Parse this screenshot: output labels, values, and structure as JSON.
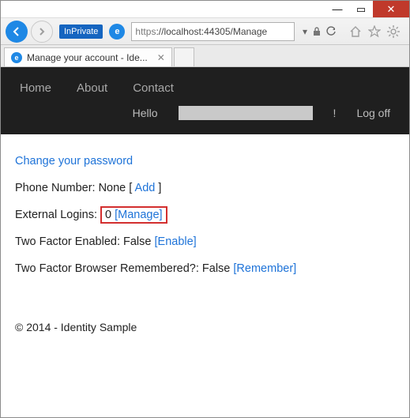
{
  "titlebar": {
    "min": "—",
    "max": "▭",
    "close": "✕"
  },
  "nav": {
    "inprivate": "InPrivate",
    "url_scheme": "https",
    "url_rest": "://localhost:44305/Manage"
  },
  "tab": {
    "title": "Manage your account - Ide..."
  },
  "site_nav": {
    "home": "Home",
    "about": "About",
    "contact": "Contact",
    "hello": "Hello",
    "bang": "!",
    "logoff": "Log off"
  },
  "page": {
    "change_pw": "Change your password",
    "phone_label": "Phone Number: None [ ",
    "phone_add": "Add",
    "phone_close": " ]",
    "ext_label": "External Logins:",
    "ext_count": "0",
    "ext_manage": "[Manage]",
    "tf_label": "Two Factor Enabled: False ",
    "tf_enable": "[Enable]",
    "br_label": "Two Factor Browser Remembered?: False ",
    "br_remember": "[Remember]"
  },
  "footer": {
    "text": "© 2014 - Identity Sample"
  }
}
